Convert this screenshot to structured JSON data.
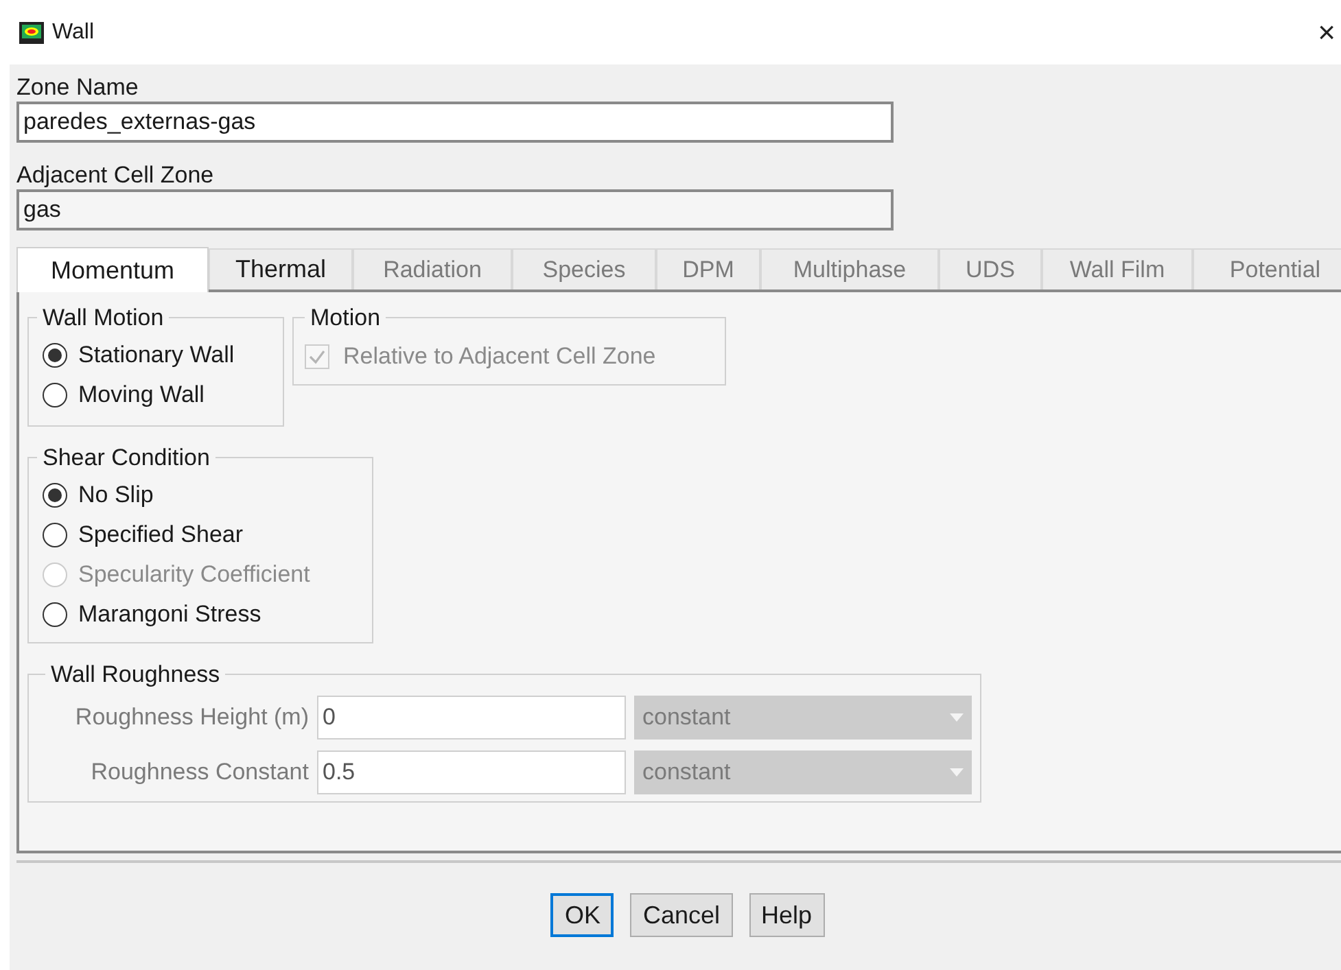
{
  "window": {
    "title": "Wall",
    "close": "×"
  },
  "zone_name": {
    "label": "Zone Name",
    "value": "paredes_externas-gas"
  },
  "adjacent_cell_zone": {
    "label": "Adjacent Cell Zone",
    "value": "gas"
  },
  "tabs": [
    {
      "label": "Momentum",
      "selected": true,
      "disabled": false
    },
    {
      "label": "Thermal",
      "selected": false,
      "disabled": false
    },
    {
      "label": "Radiation",
      "selected": false,
      "disabled": true
    },
    {
      "label": "Species",
      "selected": false,
      "disabled": true
    },
    {
      "label": "DPM",
      "selected": false,
      "disabled": true
    },
    {
      "label": "Multiphase",
      "selected": false,
      "disabled": true
    },
    {
      "label": "UDS",
      "selected": false,
      "disabled": true
    },
    {
      "label": "Wall Film",
      "selected": false,
      "disabled": true
    },
    {
      "label": "Potential",
      "selected": false,
      "disabled": true
    }
  ],
  "wall_motion": {
    "title": "Wall Motion",
    "options": [
      {
        "label": "Stationary Wall",
        "selected": true,
        "disabled": false
      },
      {
        "label": "Moving Wall",
        "selected": false,
        "disabled": false
      }
    ]
  },
  "motion": {
    "title": "Motion",
    "checkbox": {
      "label": "Relative to Adjacent Cell Zone",
      "checked": true,
      "disabled": true
    }
  },
  "shear_condition": {
    "title": "Shear Condition",
    "options": [
      {
        "label": "No Slip",
        "selected": true,
        "disabled": false
      },
      {
        "label": "Specified Shear",
        "selected": false,
        "disabled": false
      },
      {
        "label": "Specularity Coefficient",
        "selected": false,
        "disabled": true
      },
      {
        "label": "Marangoni Stress",
        "selected": false,
        "disabled": false
      }
    ]
  },
  "wall_roughness": {
    "title": "Wall Roughness",
    "rows": [
      {
        "label": "Roughness Height (m)",
        "value": "0",
        "method": "constant",
        "disabled": true
      },
      {
        "label": "Roughness Constant",
        "value": "0.5",
        "method": "constant",
        "disabled": true
      }
    ]
  },
  "buttons": [
    {
      "label": "OK",
      "focused": true
    },
    {
      "label": "Cancel",
      "focused": false
    },
    {
      "label": "Help",
      "focused": false
    }
  ]
}
